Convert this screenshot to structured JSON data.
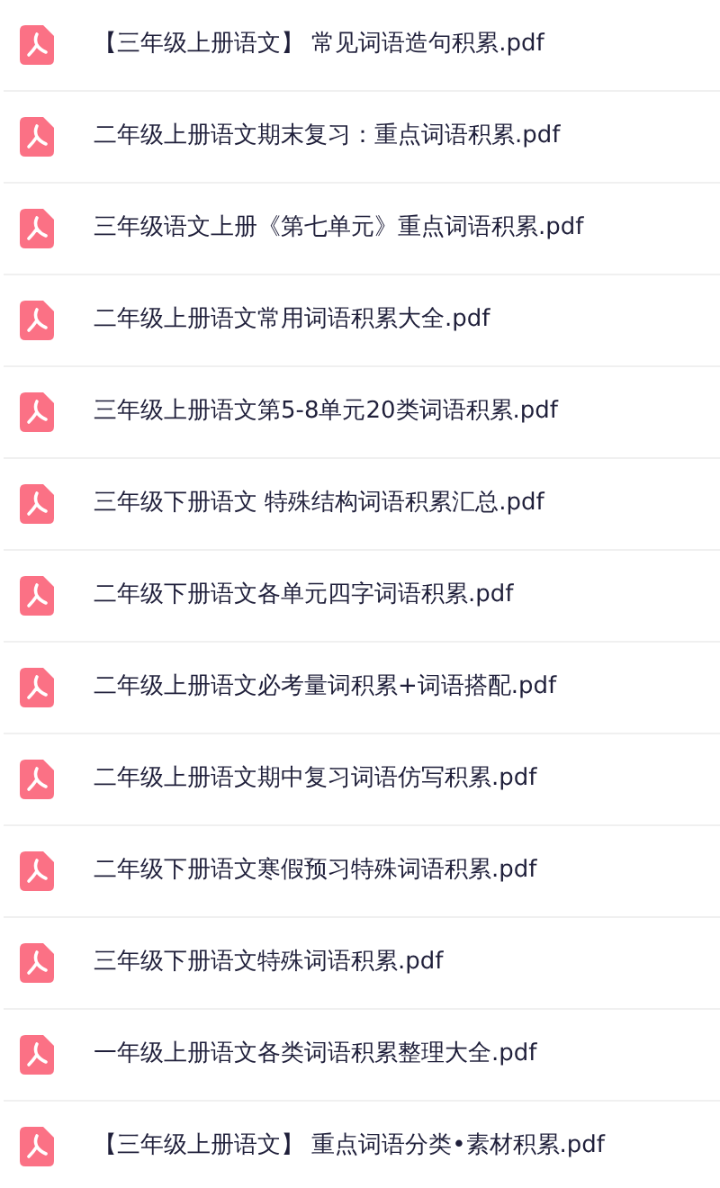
{
  "files": [
    {
      "name": "【三年级上册语文】 常见词语造句积累.pdf"
    },
    {
      "name": "二年级上册语文期末复习：重点词语积累.pdf"
    },
    {
      "name": "三年级语文上册《第七单元》重点词语积累.pdf"
    },
    {
      "name": "二年级上册语文常用词语积累大全.pdf"
    },
    {
      "name": "三年级上册语文第5-8单元20类词语积累.pdf"
    },
    {
      "name": "三年级下册语文 特殊结构词语积累汇总.pdf"
    },
    {
      "name": "二年级下册语文各单元四字词语积累.pdf"
    },
    {
      "name": "二年级上册语文必考量词积累+词语搭配.pdf"
    },
    {
      "name": "二年级上册语文期中复习词语仿写积累.pdf"
    },
    {
      "name": "二年级下册语文寒假预习特殊词语积累.pdf"
    },
    {
      "name": "三年级下册语文特殊词语积累.pdf"
    },
    {
      "name": "一年级上册语文各类词语积累整理大全.pdf"
    },
    {
      "name": "【三年级上册语文】 重点词语分类•素材积累.pdf"
    }
  ]
}
